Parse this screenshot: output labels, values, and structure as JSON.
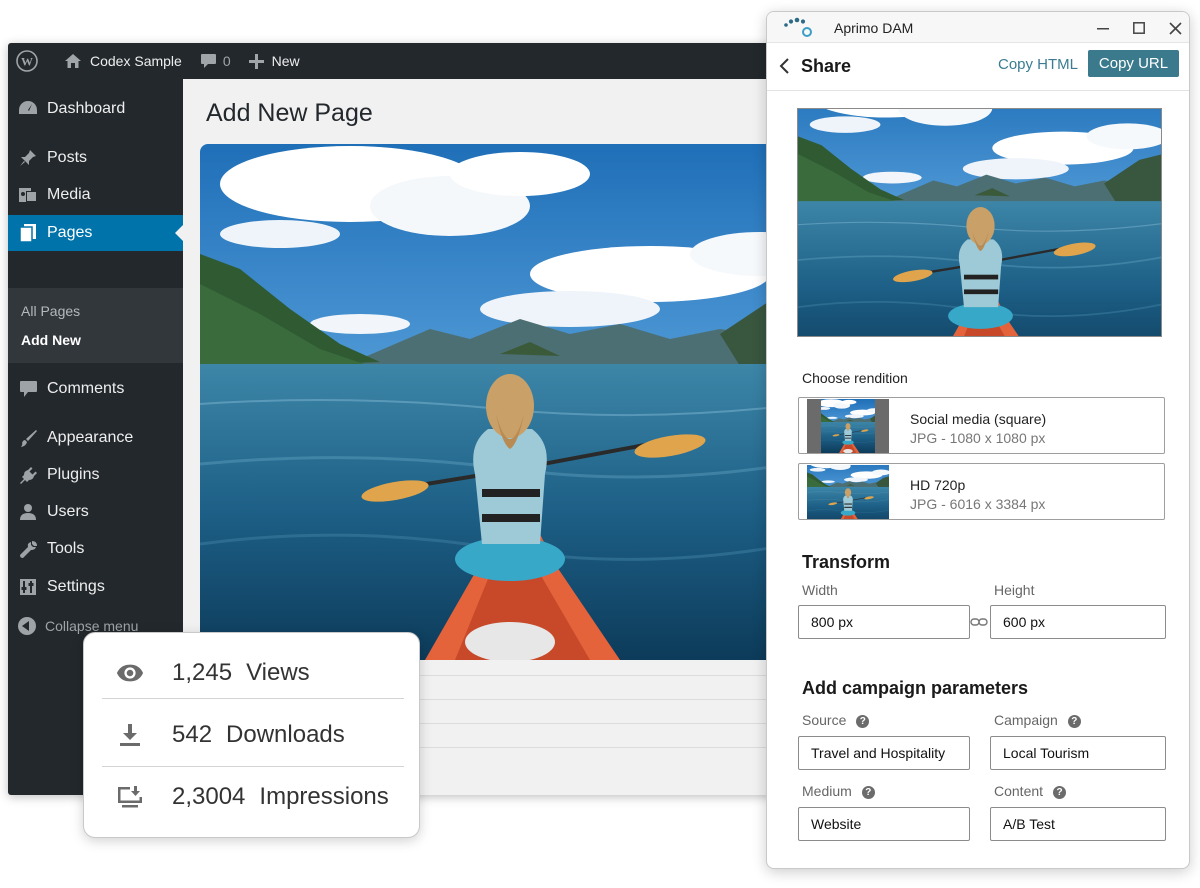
{
  "wp": {
    "adminbar": {
      "site_name": "Codex Sample",
      "comments_count": "0",
      "new_label": "New"
    },
    "menu": {
      "dashboard": "Dashboard",
      "posts": "Posts",
      "media": "Media",
      "pages": "Pages",
      "all_pages": "All Pages",
      "add_new": "Add New",
      "comments": "Comments",
      "appearance": "Appearance",
      "plugins": "Plugins",
      "users": "Users",
      "tools": "Tools",
      "settings": "Settings",
      "collapse": "Collapse menu"
    },
    "page_title": "Add New Page"
  },
  "stats": {
    "views": {
      "value": "1,245",
      "label": "Views",
      "icon": "eye-icon"
    },
    "downloads": {
      "value": "542",
      "label": "Downloads",
      "icon": "download-icon"
    },
    "impressions": {
      "value": "2,3004",
      "label": "Impressions",
      "icon": "monitor-download-icon"
    }
  },
  "aprimo": {
    "app_title": "Aprimo DAM",
    "header": {
      "title": "Share",
      "copy_html": "Copy HTML",
      "copy_url": "Copy URL"
    },
    "renditions": {
      "label": "Choose rendition",
      "items": [
        {
          "name": "Social media (square)",
          "meta": "JPG - 1080 x 1080 px"
        },
        {
          "name": "HD 720p",
          "meta": "JPG - 6016 x 3384 px"
        }
      ]
    },
    "transform": {
      "title": "Transform",
      "width_label": "Width",
      "width_value": "800 px",
      "height_label": "Height",
      "height_value": "600 px"
    },
    "campaign": {
      "title": "Add campaign parameters",
      "source_label": "Source",
      "source_value": "Travel and Hospitality",
      "campaign_label": "Campaign",
      "campaign_value": "Local Tourism",
      "medium_label": "Medium",
      "medium_value": "Website",
      "content_label": "Content",
      "content_value": "A/B Test"
    }
  },
  "colors": {
    "wp_blue": "#0073aa",
    "wp_dark": "#23282d",
    "aprimo_teal": "#3a7a8c"
  }
}
